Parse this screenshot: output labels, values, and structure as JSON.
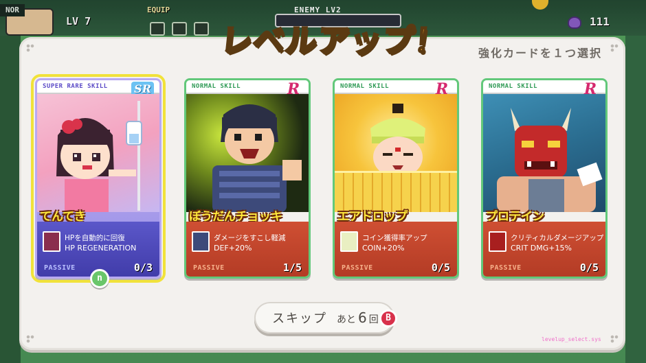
{
  "hud": {
    "player_tag": "NOR",
    "player_level": "LV 7",
    "equip_label": "EQUIP",
    "enemy_label": "ENEMY LV2",
    "currency_count": "111"
  },
  "dialog": {
    "title": "レベルアップ！",
    "subtitle": "強化カードを１つ選択",
    "scene_id": "levelup_select.sys"
  },
  "cards": [
    {
      "rarity_label": "SUPER RARE SKILL",
      "rarity_badge": "SR",
      "name": "てんてき",
      "skill_jp": "HPを自動的に回復",
      "skill_en": "HP REGENERATION",
      "type": "PASSIVE",
      "level": "0/3",
      "selected": true,
      "icon": "iv-drip-icon"
    },
    {
      "rarity_label": "NORMAL SKILL",
      "rarity_badge": "R",
      "name": "ぼうだんチョッキ",
      "skill_jp": "ダメージをすこし軽減",
      "skill_en": "DEF+20%",
      "type": "PASSIVE",
      "level": "1/5",
      "selected": false,
      "icon": "vest-icon"
    },
    {
      "rarity_label": "NORMAL SKILL",
      "rarity_badge": "R",
      "name": "エアドロップ",
      "skill_jp": "コイン獲得率アップ",
      "skill_en": "COIN+20%",
      "type": "PASSIVE",
      "level": "0/5",
      "selected": false,
      "icon": "coin-face-icon"
    },
    {
      "rarity_label": "NORMAL SKILL",
      "rarity_badge": "R",
      "name": "プロテイン",
      "skill_jp": "クリティカルダメージアップ",
      "skill_en": "CRIT DMG+15%",
      "type": "PASSIVE",
      "level": "0/5",
      "selected": false,
      "icon": "oni-mask-icon"
    }
  ],
  "select_indicator": "n",
  "skip": {
    "label": "スキップ",
    "remaining_prefix": "あと",
    "remaining_count": "6",
    "remaining_suffix": "回",
    "button_glyph": "B"
  }
}
